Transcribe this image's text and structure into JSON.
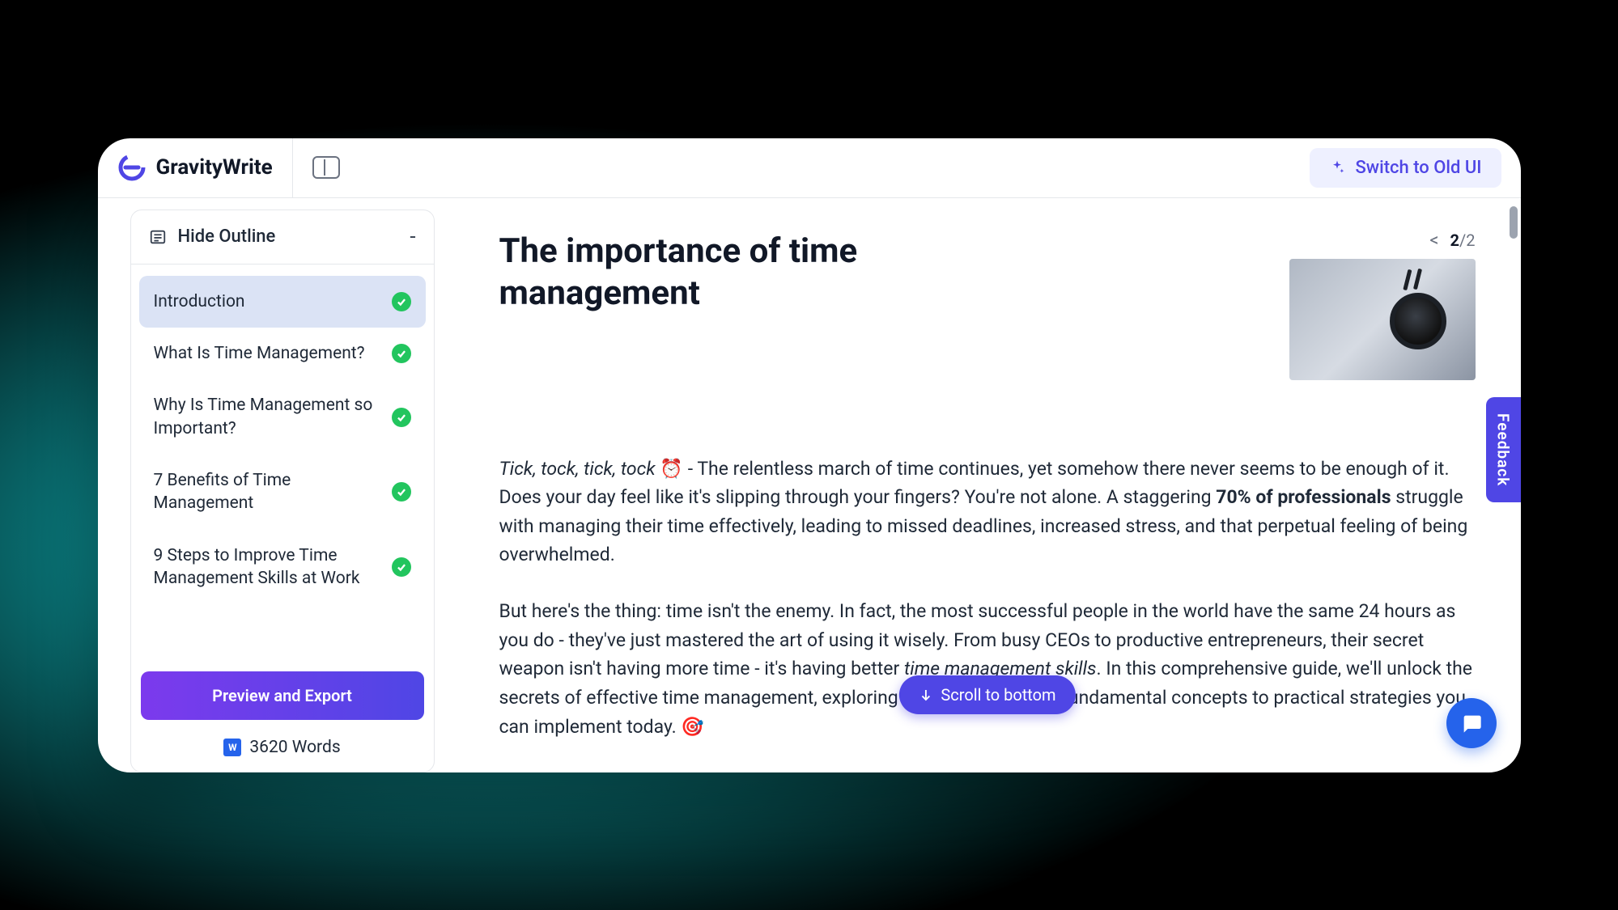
{
  "brand": {
    "name": "GravityWrite"
  },
  "header": {
    "switch_label": "Switch to Old UI"
  },
  "sidebar": {
    "hide_outline_label": "Hide Outline",
    "items": [
      {
        "label": "Introduction",
        "done": true,
        "active": true
      },
      {
        "label": "What Is Time Management?",
        "done": true,
        "active": false
      },
      {
        "label": "Why Is Time Management so Important?",
        "done": true,
        "active": false
      },
      {
        "label": "7 Benefits of Time Management",
        "done": true,
        "active": false
      },
      {
        "label": "9 Steps to Improve Time Management Skills at Work",
        "done": true,
        "active": false
      }
    ],
    "preview_label": "Preview and Export",
    "word_count": "3620 Words"
  },
  "doc": {
    "title": "The importance of time management",
    "pager": {
      "current": "2",
      "total": "/2",
      "prev": "<"
    },
    "p1_italic": "Tick, tock, tick, tock",
    "p1_emoji": " ⏰ ",
    "p1_a": "- The relentless march of time continues, yet somehow there never seems to be enough of it. Does your day feel like it's slipping through your fingers? You're not alone. A staggering ",
    "p1_bold": "70% of professionals",
    "p1_b": " struggle with managing their time effectively, leading to missed deadlines, increased stress, and that perpetual feeling of being overwhelmed.",
    "p2_a": "But here's the thing: time isn't the enemy. In fact, the most successful people in the world have the same 24 hours as you do - they've just mastered the art of using it wisely. From busy CEOs to productive entrepreneurs, their secret weapon isn't having more time - it's having better ",
    "p2_italic": "time management skills",
    "p2_b": ". In this comprehensive guide, we'll unlock the secrets of effective time management, exploring everything from its fundamental concepts to practical strategies you can implement today. 🎯"
  },
  "scroll_label": "Scroll to bottom",
  "feedback_label": "Feedback"
}
